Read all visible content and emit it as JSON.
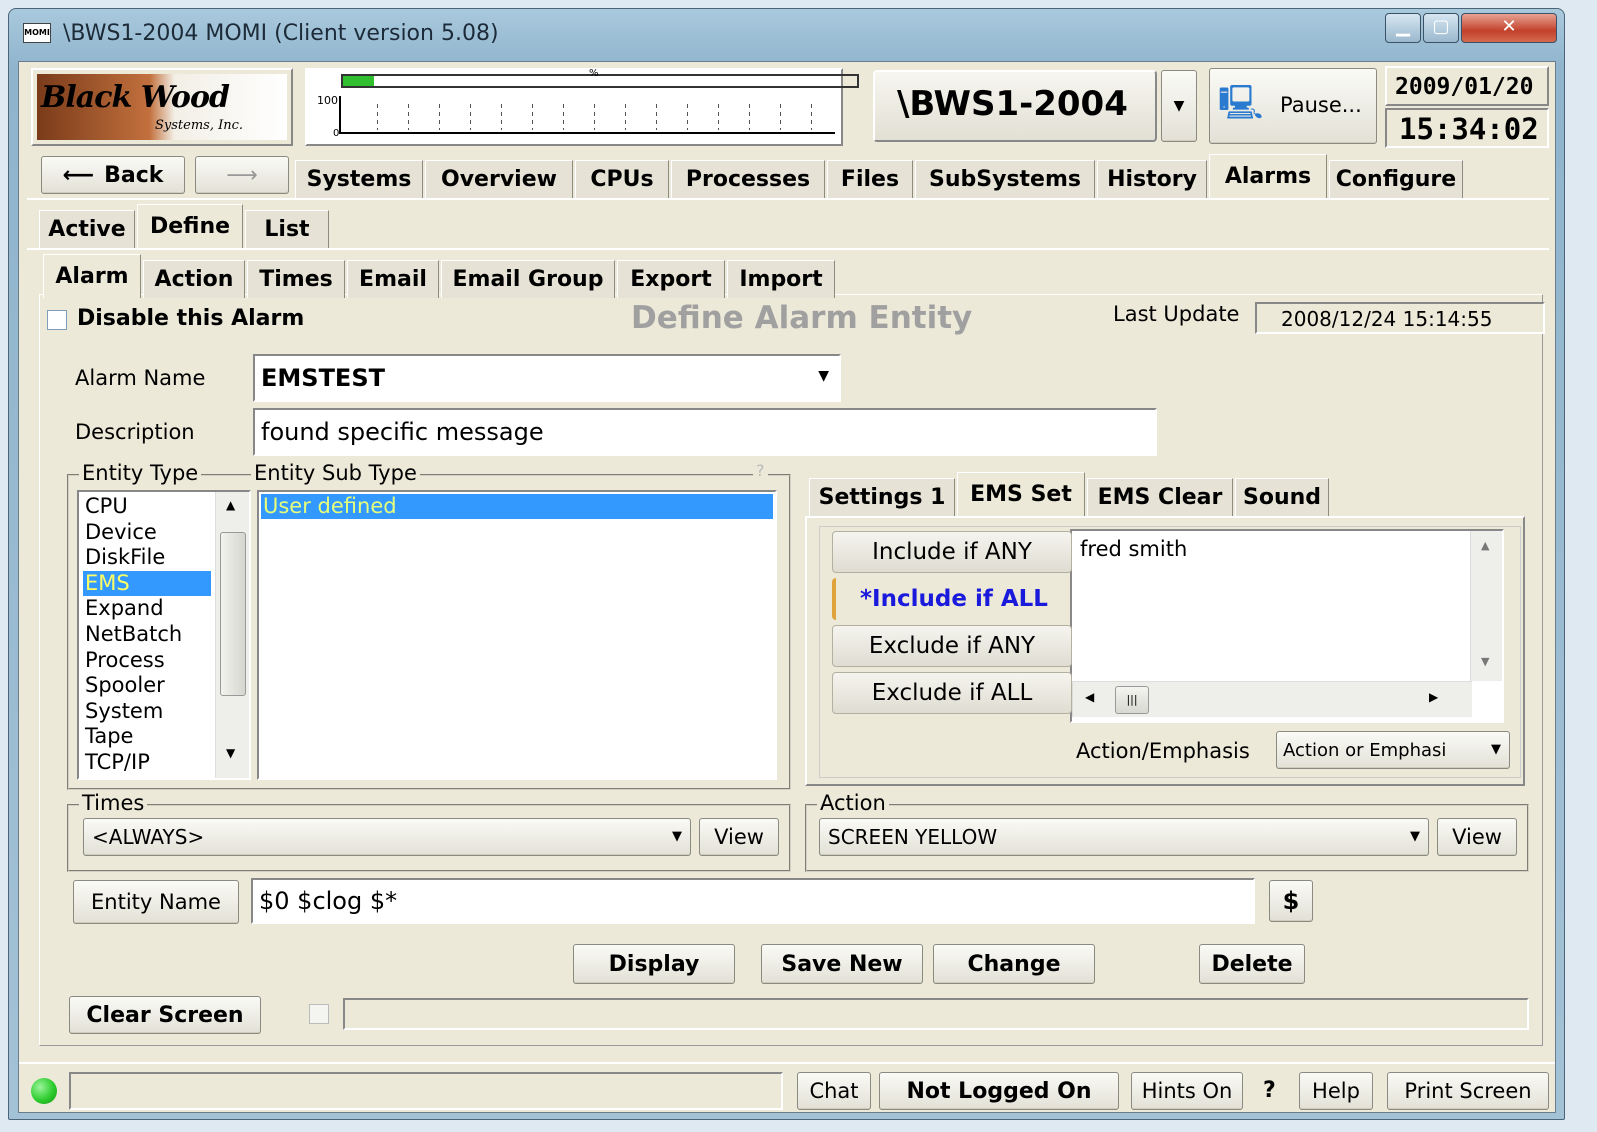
{
  "window": {
    "title": "\\BWS1-2004 MOMI (Client version 5.08)",
    "icon_label": "MOMI"
  },
  "header": {
    "logo": {
      "line1": "Black Wood",
      "line2": "Systems, Inc."
    },
    "meter": {
      "pct_label": "%",
      "scale_top": "100",
      "scale_bottom": "0",
      "level_pct": 6
    },
    "system_name": "\\BWS1-2004",
    "pause_label": "Pause...",
    "date": "2009/01/20",
    "time": "15:34:02"
  },
  "nav": {
    "back_label": "Back",
    "tabs": [
      "Systems",
      "Overview",
      "CPUs",
      "Processes",
      "Files",
      "SubSystems",
      "History",
      "Alarms",
      "Configure"
    ],
    "selected": "Alarms"
  },
  "subnav": {
    "tabs": [
      "Active",
      "Define",
      "List"
    ],
    "selected": "Define"
  },
  "subsubnav": {
    "tabs": [
      "Alarm",
      "Action",
      "Times",
      "Email",
      "Email Group",
      "Export",
      "Import"
    ],
    "selected": "Alarm"
  },
  "form": {
    "disable_label": "Disable this Alarm",
    "section_title": "Define Alarm Entity",
    "last_update_label": "Last Update",
    "last_update_value": "2008/12/24 15:14:55",
    "alarm_name_label": "Alarm Name",
    "alarm_name_value": "EMSTEST",
    "description_label": "Description",
    "description_value": "found specific message",
    "entity_type_label": "Entity Type",
    "entity_sub_type_label": "Entity Sub Type",
    "help_mark": "?",
    "entity_types": [
      "CPU",
      "Device",
      "DiskFile",
      "EMS",
      "Expand",
      "NetBatch",
      "Process",
      "Spooler",
      "System",
      "Tape",
      "TCP/IP"
    ],
    "entity_type_selected": "EMS",
    "entity_sub_types": [
      "User defined"
    ],
    "ems_tabs": [
      "Settings 1",
      "EMS Set",
      "EMS Clear",
      "Sound"
    ],
    "ems_tab_selected": "EMS Set",
    "ems_buttons": [
      "Include if ANY",
      "*Include if ALL",
      "Exclude if ANY",
      "Exclude if ALL"
    ],
    "ems_selected": "*Include if ALL",
    "ems_text": "fred smith",
    "action_emphasis_label": "Action/Emphasis",
    "action_emphasis_value": "Action or Emphasi",
    "times_label": "Times",
    "times_value": "<ALWAYS>",
    "action_label": "Action",
    "action_value": "SCREEN YELLOW",
    "view_label": "View",
    "entity_name_button": "Entity Name",
    "entity_name_value": "$0 $clog $*",
    "dollar_button": "$",
    "buttons": {
      "display": "Display",
      "save_new": "Save New",
      "change": "Change",
      "delete": "Delete",
      "clear_screen": "Clear Screen"
    }
  },
  "statusbar": {
    "chat": "Chat",
    "login": "Not Logged On",
    "hints": "Hints On",
    "question": "?",
    "help": "Help",
    "print": "Print Screen"
  },
  "colors": {
    "accent_select": "#3399ff",
    "status_led": "#2ecc2e",
    "ems_selected_text": "#1a1adc",
    "title_gray": "#a0a0a0"
  }
}
